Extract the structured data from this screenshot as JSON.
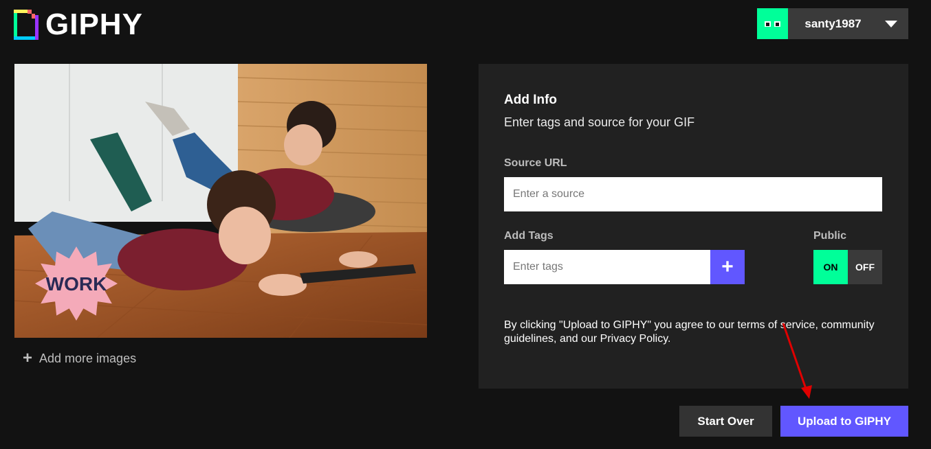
{
  "header": {
    "logo_text": "GIPHY",
    "username": "santy1987"
  },
  "preview": {
    "sticker_text": "WORK",
    "add_more_label": "Add more images"
  },
  "panel": {
    "title": "Add Info",
    "subtitle": "Enter tags and source for your GIF",
    "source_label": "Source URL",
    "source_placeholder": "Enter a source",
    "source_value": "",
    "tags_label": "Add Tags",
    "tags_placeholder": "Enter tags",
    "tags_value": "",
    "add_tag_button": "+",
    "public_label": "Public",
    "public_on": "ON",
    "public_off": "OFF",
    "public_state": "ON",
    "terms_text": "By clicking \"Upload to GIPHY\" you agree to our terms of service, community guidelines, and our Privacy Policy."
  },
  "actions": {
    "start_over": "Start Over",
    "upload": "Upload to GIPHY"
  },
  "colors": {
    "background": "#121212",
    "panel": "#212121",
    "accent_purple": "#6157ff",
    "accent_green": "#00ff99",
    "annotation_arrow": "#e00000"
  },
  "icons": {
    "logo": "giphy-logo-icon",
    "avatar": "googly-eyes-icon",
    "caret": "chevron-down-icon",
    "add_more": "plus-icon",
    "add_tag": "plus-icon"
  }
}
